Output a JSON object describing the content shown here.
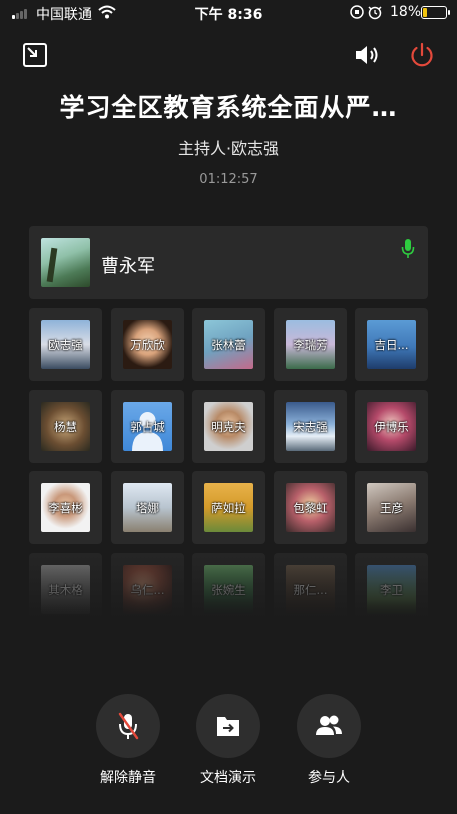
{
  "status_bar": {
    "carrier": "中国联通",
    "time": "下午 8:36",
    "battery": "18%"
  },
  "meeting": {
    "title": "学习全区教育系统全面从严…",
    "host": "主持人·欧志强",
    "elapsed": "01:12:57"
  },
  "active_speaker": {
    "name": "曹永军",
    "mic_color": "#2ecc40"
  },
  "participants": [
    {
      "name": "欧志强"
    },
    {
      "name": "万欣欣"
    },
    {
      "name": "张林蕾"
    },
    {
      "name": "李瑞芳"
    },
    {
      "name": "吉日..."
    },
    {
      "name": "杨慧"
    },
    {
      "name": "郭占城"
    },
    {
      "name": "明克夫"
    },
    {
      "name": "宋志强"
    },
    {
      "name": "伊博乐"
    },
    {
      "name": "李喜彬"
    },
    {
      "name": "塔娜"
    },
    {
      "name": "萨如拉"
    },
    {
      "name": "包黎虹"
    },
    {
      "name": "王彦"
    },
    {
      "name": "其木格"
    },
    {
      "name": "乌仁..."
    },
    {
      "name": "张婉生"
    },
    {
      "name": "那仁..."
    },
    {
      "name": "李卫"
    }
  ],
  "controls": {
    "unmute": "解除静音",
    "doc_share": "文档演示",
    "participants": "参与人"
  },
  "colors": {
    "accent_red": "#e3493b",
    "mic_green": "#2ecc40",
    "battery_yellow": "#f1c40f"
  }
}
